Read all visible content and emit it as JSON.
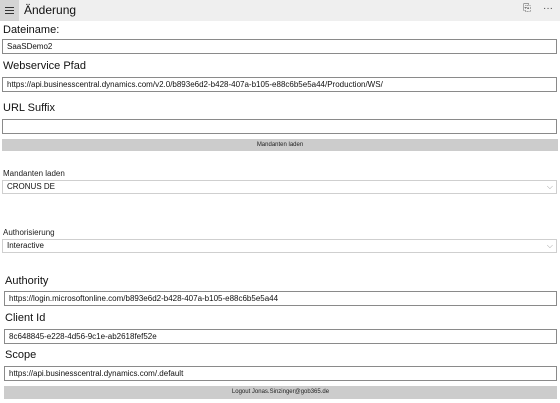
{
  "window": {
    "title": "Änderung",
    "menu_icon": "hamburger-menu-icon",
    "share_icon": "share-icon",
    "more_icon": "more-options-icon",
    "share_glyph": "⎘",
    "more_glyph": "···"
  },
  "form": {
    "dateiname": {
      "label": "Dateiname:",
      "value": "SaaSDemo2"
    },
    "webservice": {
      "label": "Webservice Pfad",
      "value": "https://api.businesscentral.dynamics.com/v2.0/b893e6d2-b428-407a-b105-e88c6b5e5a44/Production/WS/"
    },
    "url_suffix": {
      "label": "URL Suffix",
      "value": ""
    },
    "mandanten_button": "Mandanten laden",
    "mandanten": {
      "label": "Mandanten laden",
      "selected": "CRONUS DE"
    },
    "authorisierung": {
      "label": "Authorisierung",
      "selected": "Interactive"
    },
    "authority": {
      "label": "Authority",
      "value": "https://login.microsoftonline.com/b893e6d2-b428-407a-b105-e88c6b5e5a44"
    },
    "client_id": {
      "label": "Client Id",
      "value": "8c648845-e228-4d56-9c1e-ab2618fef52e"
    },
    "scope": {
      "label": "Scope",
      "value": "https://api.businesscentral.dynamics.com/.default"
    },
    "logout_button": "Logout Jonas.Sinzinger@gob365.de"
  },
  "chevron_glyph": "⌵"
}
